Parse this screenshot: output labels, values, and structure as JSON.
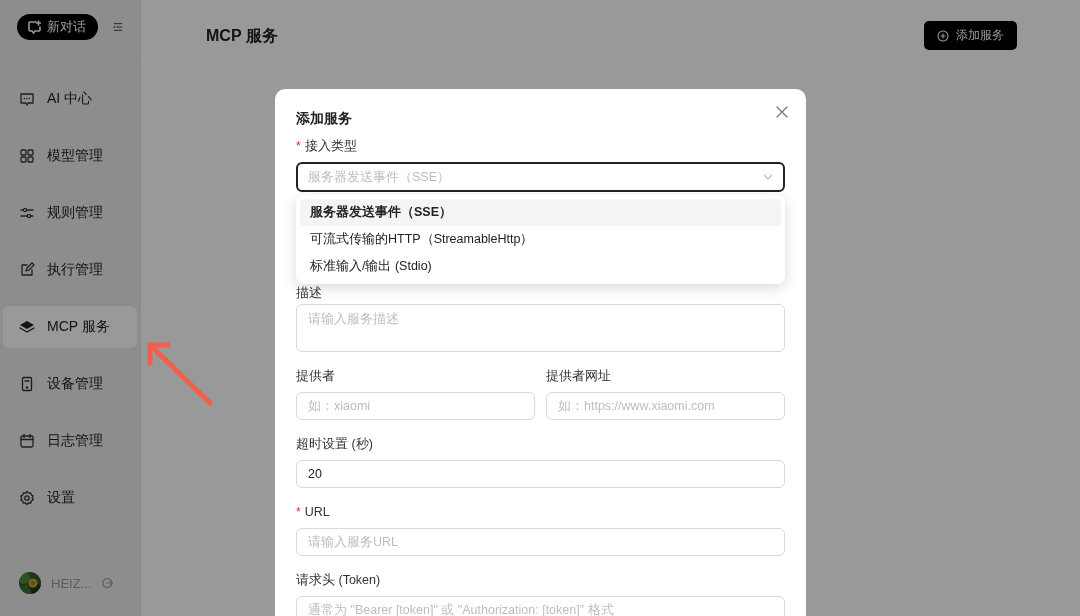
{
  "sidebar": {
    "new_chat_button": "新对话",
    "items": [
      {
        "label": "AI 中心",
        "selected": false
      },
      {
        "label": "模型管理",
        "selected": false
      },
      {
        "label": "规则管理",
        "selected": false
      },
      {
        "label": "执行管理",
        "selected": false
      },
      {
        "label": "MCP 服务",
        "selected": true
      },
      {
        "label": "设备管理",
        "selected": false
      },
      {
        "label": "日志管理",
        "selected": false
      },
      {
        "label": "设置",
        "selected": false
      }
    ],
    "user": {
      "name": "HEIZ..."
    }
  },
  "header": {
    "title": "MCP 服务",
    "add_button": "添加服务"
  },
  "dialog": {
    "title": "添加服务",
    "access_type": {
      "required_mark": "*",
      "label": "接入类型",
      "placeholder": "服务器发送事件（SSE）",
      "options": [
        {
          "label": "服务器发送事件（SSE）",
          "selected": true
        },
        {
          "label": "可流式传输的HTTP（StreamableHttp）",
          "selected": false
        },
        {
          "label": "标准输入/输出 (Stdio)",
          "selected": false
        }
      ]
    },
    "fields": [
      {
        "kind": "textarea",
        "label": "描述",
        "placeholder": "请输入服务描述"
      },
      {
        "kind": "pair",
        "columns": [
          {
            "label": "提供者",
            "placeholder": "如：xiaomi"
          },
          {
            "label": "提供者网址",
            "placeholder": "如：https://www.xiaomi.com"
          }
        ]
      },
      {
        "kind": "text",
        "label": "超时设置 (秒)",
        "value": "20"
      },
      {
        "kind": "text",
        "required_mark": "*",
        "label": "URL",
        "placeholder": "请输入服务URL"
      },
      {
        "kind": "text",
        "label": "请求头 (Token)",
        "placeholder": "通常为 \"Bearer [token]\" 或 \"Authorization: [token]\" 格式"
      }
    ]
  }
}
